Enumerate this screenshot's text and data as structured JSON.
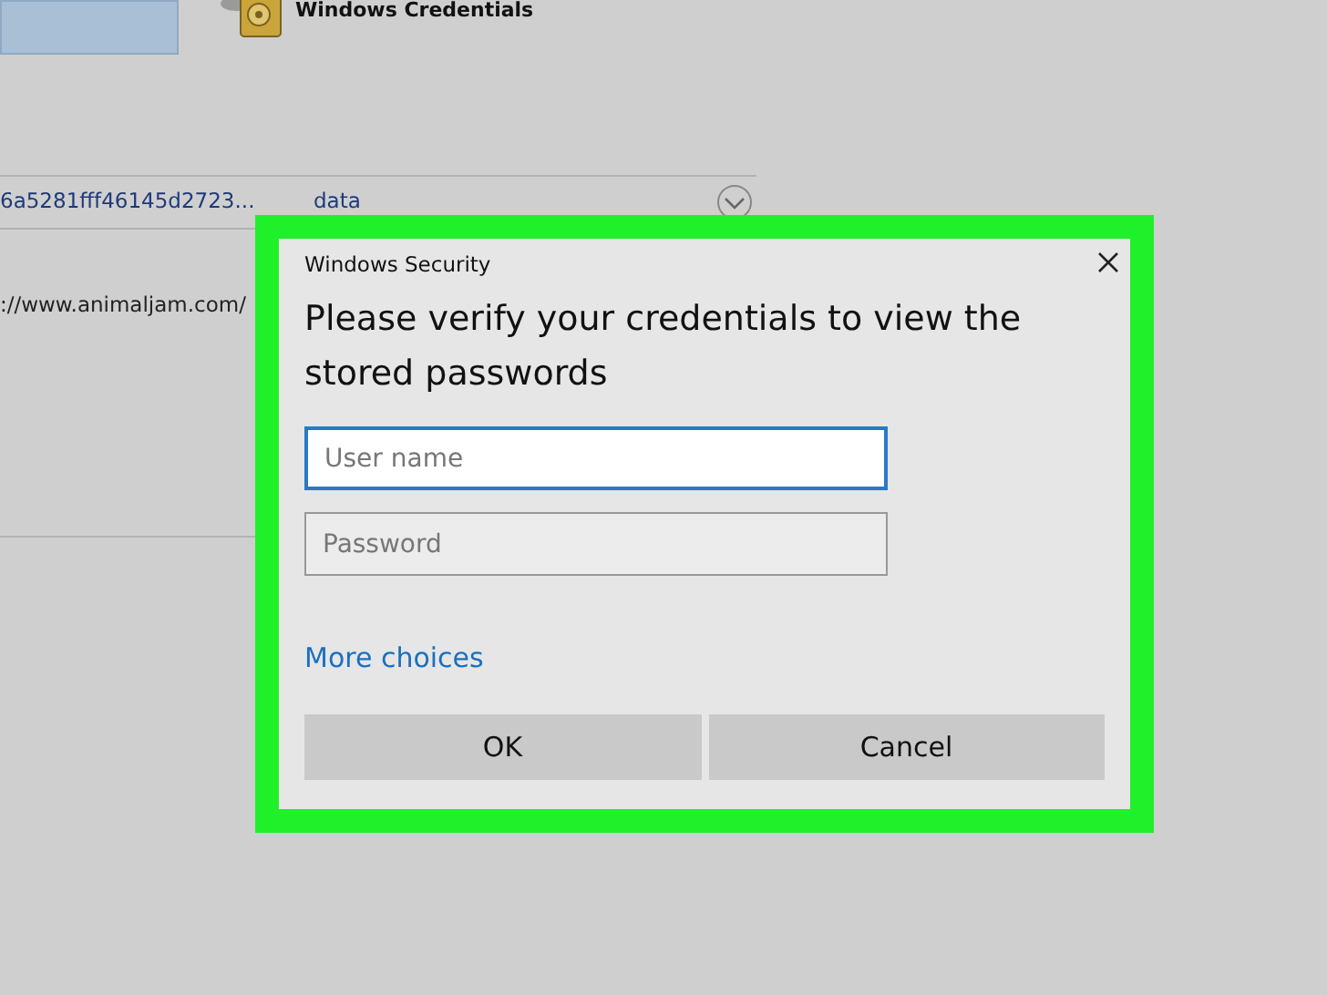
{
  "background": {
    "tile": {
      "selected": true
    },
    "heading": "Windows Credentials",
    "rows": [
      {
        "column_1": "6a5281fff46145d2723...",
        "column_2": "data",
        "expanded": false
      },
      {
        "column_1": "://www.animaljam.com/"
      }
    ]
  },
  "dialog": {
    "title": "Windows Security",
    "message": "Please verify your credentials to view the stored passwords",
    "fields": [
      {
        "placeholder": "User name",
        "focused": true
      },
      {
        "placeholder": "Password",
        "focused": false
      }
    ],
    "link": "More choices",
    "buttons": [
      "OK",
      "Cancel"
    ]
  }
}
